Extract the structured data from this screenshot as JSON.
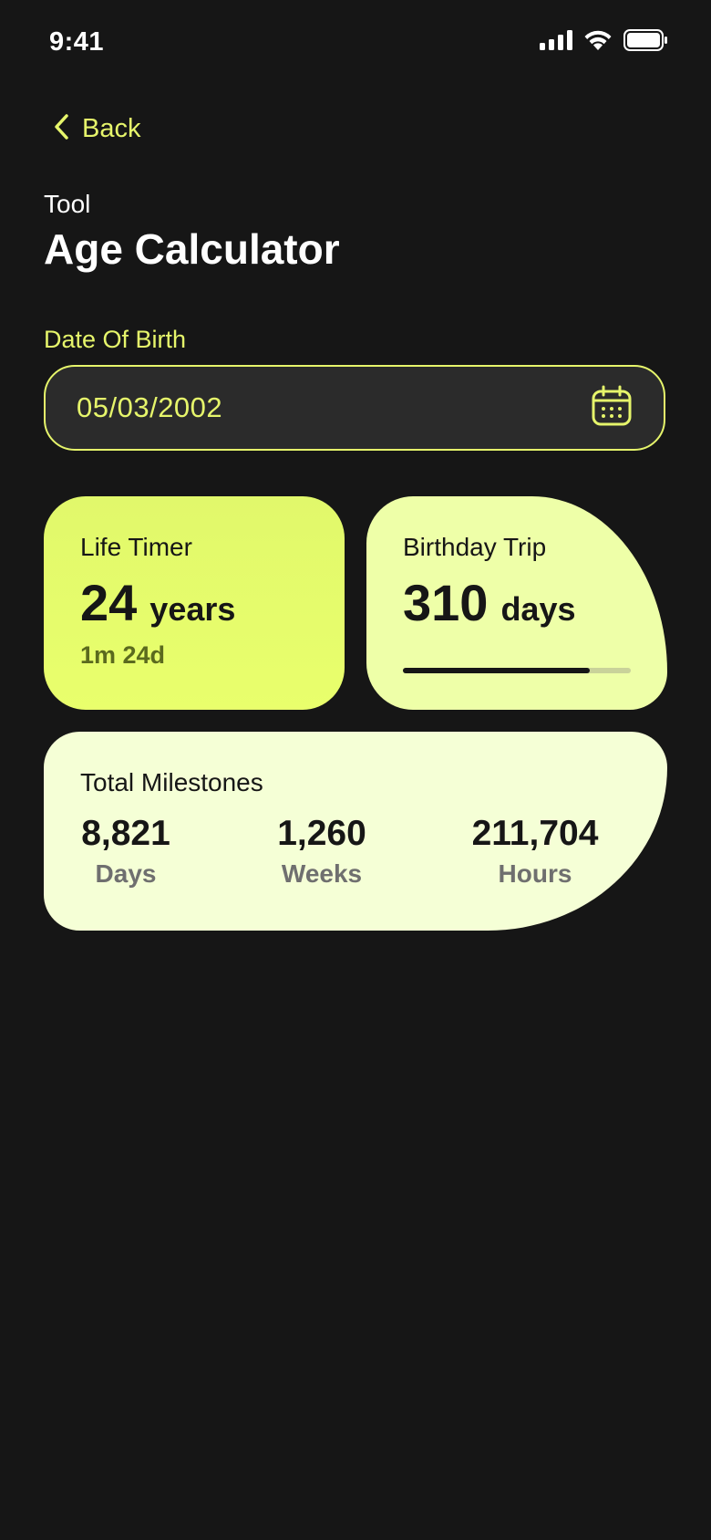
{
  "status_bar": {
    "time": "9:41",
    "icons": [
      "signal-icon",
      "wifi-icon",
      "battery-icon"
    ]
  },
  "nav": {
    "back_label": "Back",
    "back_icon": "chevron-left-icon"
  },
  "header": {
    "eyebrow": "Tool",
    "title": "Age Calculator"
  },
  "date_of_birth": {
    "label": "Date Of Birth",
    "value": "05/03/2002",
    "icon": "calendar-icon"
  },
  "life_timer": {
    "title": "Life Timer",
    "value": "24",
    "unit": "years",
    "detail": "1m 24d"
  },
  "birthday_trip": {
    "title": "Birthday Trip",
    "value": "310",
    "unit": "days",
    "progress": 0.82
  },
  "milestones": {
    "title": "Total Milestones",
    "items": [
      {
        "value": "8,821",
        "label": "Days"
      },
      {
        "value": "1,260",
        "label": "Weeks"
      },
      {
        "value": "211,704",
        "label": "Hours"
      }
    ]
  },
  "colors": {
    "background": "#161616",
    "accent": "#E6F56B",
    "card_life": "#E6FB6C",
    "card_trip": "#EEFFA8",
    "card_total": "#F5FFD6"
  }
}
